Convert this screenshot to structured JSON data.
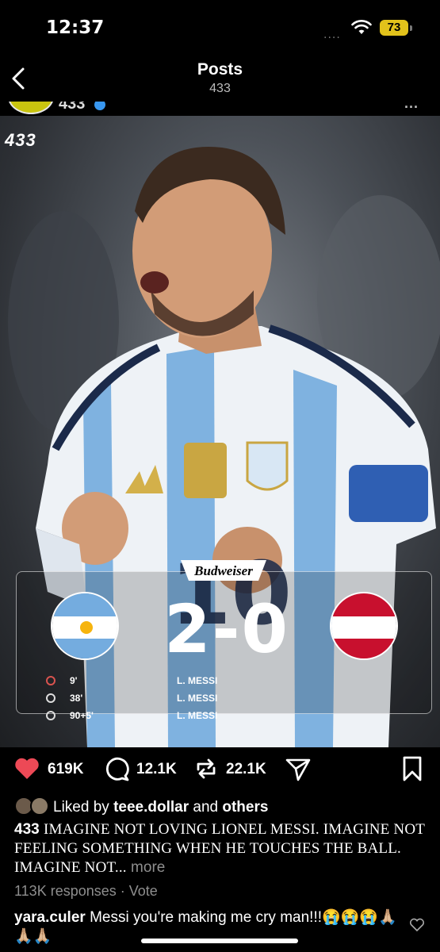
{
  "status_bar": {
    "time": "12:37",
    "signal": "....",
    "battery": "73"
  },
  "header": {
    "title": "Posts",
    "subtitle": "433"
  },
  "post": {
    "username": "433",
    "more": "...",
    "brand": "433",
    "sponsor": "Budweiser",
    "match": {
      "home_score": "2",
      "separator": "-",
      "away_score": "0",
      "goals": [
        {
          "minute": "9'",
          "player": "L. MESSI"
        },
        {
          "minute": "38'",
          "player": "L. MESSI"
        },
        {
          "minute": "90+5'",
          "player": "L. MESSI"
        }
      ]
    },
    "actions": {
      "likes": "619K",
      "comments": "12.1K",
      "reposts": "22.1K"
    },
    "liked_by": {
      "prefix": "Liked by",
      "user": "teee.dollar",
      "connector": "and",
      "others": "others"
    },
    "caption": {
      "user": "433",
      "text": "IMAGINE NOT LOVING LIONEL MESSI. IMAGINE NOT FEELING SOMETHING WHEN HE TOUCHES THE BALL. IMAGINE NOT...",
      "more": "more"
    },
    "responses": "113K responses · Vote",
    "comment": {
      "user": "yara.culer",
      "text": "Messi you're making me cry man!!!😭😭😭🙏🏼🙏🏼🙏🏼"
    }
  },
  "colors": {
    "accent_like": "#ed4956",
    "battery": "#e2c21b",
    "arg_blue": "#74acdf",
    "aut_red": "#c8102e"
  }
}
